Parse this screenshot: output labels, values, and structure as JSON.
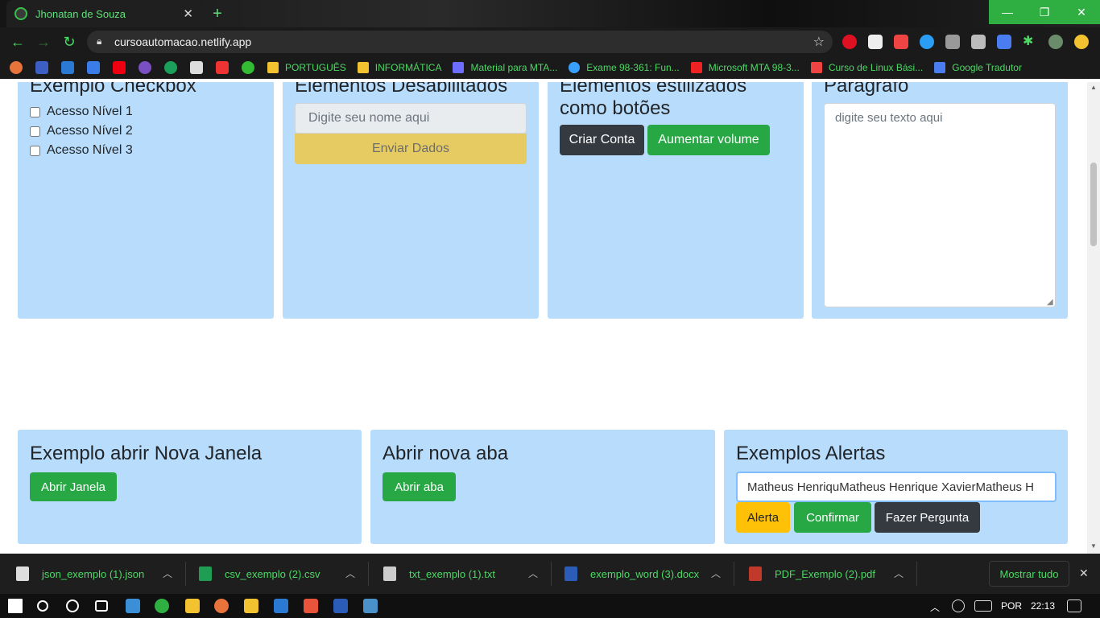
{
  "browser": {
    "tab_title": "Jhonatan de Souza",
    "new_tab_label": "+",
    "url": "cursoautomacao.netlify.app",
    "window_controls": {
      "minimize": "—",
      "restore": "❐",
      "close": "✕"
    }
  },
  "bookmarks": [
    {
      "label": "PORTUGUÊS",
      "color": "#f2c230"
    },
    {
      "label": "INFORMÁTICA",
      "color": "#f2c230"
    },
    {
      "label": "Material para MTA...",
      "color": "#6d6dff"
    },
    {
      "label": "Exame 98-361: Fun...",
      "color": "#3aa0ff"
    },
    {
      "label": "Microsoft MTA 98-3...",
      "color": "#e22"
    },
    {
      "label": "Curso de Linux Bási...",
      "color": "#e44"
    },
    {
      "label": "Google Tradutor",
      "color": "#4a7df0"
    }
  ],
  "page": {
    "checkbox_card": {
      "title": "Exemplo Checkbox",
      "options": [
        "Acesso Nível 1",
        "Acesso Nível 2",
        "Acesso Nível 3"
      ]
    },
    "disabled_card": {
      "title": "Elementos Desabilitados",
      "input_placeholder": "Digite seu nome aqui",
      "submit_label": "Enviar Dados"
    },
    "styled_card": {
      "title": "Elementos estilizados como botões",
      "create_account_label": "Criar Conta",
      "volume_label": "Aumentar volume"
    },
    "paragraph_card": {
      "title": "Paragrafo",
      "textarea_placeholder": "digite seu texto aqui"
    },
    "window_card": {
      "title": "Exemplo abrir Nova Janela",
      "button_label": "Abrir Janela"
    },
    "tab_card": {
      "title": "Abrir nova aba",
      "button_label": "Abrir aba"
    },
    "alerts_card": {
      "title": "Exemplos Alertas",
      "input_value": "Matheus HenriquMatheus Henrique XavierMatheus H",
      "alert_label": "Alerta",
      "confirm_label": "Confirmar",
      "question_label": "Fazer Pergunta"
    }
  },
  "downloads": {
    "items": [
      {
        "name": "json_exemplo (1).json",
        "icon_color": "#dddddd"
      },
      {
        "name": "csv_exemplo (2).csv",
        "icon_color": "#1f9d55"
      },
      {
        "name": "txt_exemplo (1).txt",
        "icon_color": "#cccccc"
      },
      {
        "name": "exemplo_word (3).docx",
        "icon_color": "#2b5cb8"
      },
      {
        "name": "PDF_Exemplo (2).pdf",
        "icon_color": "#c0392b"
      }
    ],
    "show_all_label": "Mostrar tudo"
  },
  "taskbar": {
    "language": "POR",
    "time": "22:13"
  }
}
